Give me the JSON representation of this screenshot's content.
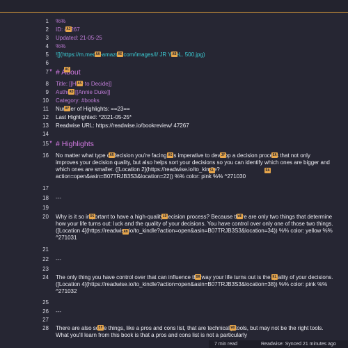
{
  "lines": [
    {
      "n": "1",
      "text": "%%",
      "cls": "purple"
    },
    {
      "n": "2",
      "text": "ID: 47267",
      "cls": "purple"
    },
    {
      "n": "3",
      "text": "Updated: 21-05-25",
      "cls": "purple"
    },
    {
      "n": "4",
      "text": "%%",
      "cls": "purple"
    },
    {
      "n": "5",
      "text": "![](https://m.media-amazon.com/images/I/  JR  YweL.  500.jpg)",
      "cls": "cyan"
    },
    {
      "n": "6",
      "text": "",
      "cls": "white"
    },
    {
      "n": "7",
      "text": "# About",
      "cls": "head"
    },
    {
      "n": "8",
      "text": "Title: [[How to Decide]]",
      "cls": "purple"
    },
    {
      "n": "9",
      "text": "Author: [[Annie Duke]]",
      "cls": "purple"
    },
    {
      "n": "10",
      "text": "Category: #books",
      "cls": "purple"
    },
    {
      "n": "11",
      "text": "Number of Highlights: ==23==",
      "cls": "white"
    },
    {
      "n": "12",
      "text": "Last Highlighted: *2021-05-25*",
      "cls": "white"
    },
    {
      "n": "13",
      "text": "Readwise URL: https://readwise.io/bookreview/ 47267",
      "cls": "white"
    },
    {
      "n": "14",
      "text": "",
      "cls": "white"
    },
    {
      "n": "15",
      "text": "# Highlights",
      "cls": "head"
    },
    {
      "n": "16",
      "text": "No matter what type of decision you're facing, it's imperative to develop a decision process that not only improves your decision quality, but also helps sort your decisions so you can identify which ones are bigger and which ones are smaller. ([Location 2](https://readwise.io/to_kindle?action=open&asin=B07TRJB3S3&location=22)) %% color: pink %% ^271030",
      "cls": "white"
    },
    {
      "n": "17",
      "text": "",
      "cls": "white"
    },
    {
      "n": "18",
      "text": "---",
      "cls": "white"
    },
    {
      "n": "19",
      "text": "",
      "cls": "white"
    },
    {
      "n": "20",
      "text": "Why is it so important to have a high-quality decision process? Because there are only two things that determine how your life turns out: luck and the quality of your decisions. You have control over only one of those two things. ([Location 4](https://readwise.io/to_kindle?action=open&asin=B07TRJB3S3&location=34)) %% color: yellow %% ^271031",
      "cls": "white"
    },
    {
      "n": "21",
      "text": "",
      "cls": "white"
    },
    {
      "n": "22",
      "text": "---",
      "cls": "white"
    },
    {
      "n": "23",
      "text": "",
      "cls": "white"
    },
    {
      "n": "24",
      "text": "The only thing you have control over that can influence the way your life turns out is the quality of your decisions. ([Location 4](https://readwise.io/to_kindle?action=open&asin=B07TRJB3S3&location=38)) %% color: pink %% ^271032",
      "cls": "white"
    },
    {
      "n": "25",
      "text": "",
      "cls": "white"
    },
    {
      "n": "26",
      "text": "---",
      "cls": "white"
    },
    {
      "n": "27",
      "text": "",
      "cls": "white"
    },
    {
      "n": "28",
      "text": "There are also some things, like a pros and cons list, that are technically tools, but may not be the right tools. What you'll learn from this book is that a pros and cons list is not a particularly",
      "cls": "white"
    }
  ],
  "status": {
    "read_time": "7 min read",
    "sync": "Readwise: Synced 21 minutes ago"
  },
  "colors": {
    "background": "#262633",
    "accent": "#e3a13b",
    "heading": "#d47be3",
    "purple_text": "#c07dd8",
    "link": "#3ccdd5",
    "highlight": "#ee4f9f",
    "hint_badge": "#e7a64b"
  },
  "hint_badges": [
    "AJ",
    "AA",
    "AE",
    "AB",
    "AC",
    "AS",
    "AD",
    "AF",
    "AR",
    "AG",
    "JF",
    "EA",
    "SL",
    "RA",
    "DS",
    "LD",
    "WE",
    "AN",
    "BR",
    "KL",
    "EF",
    "WO"
  ]
}
